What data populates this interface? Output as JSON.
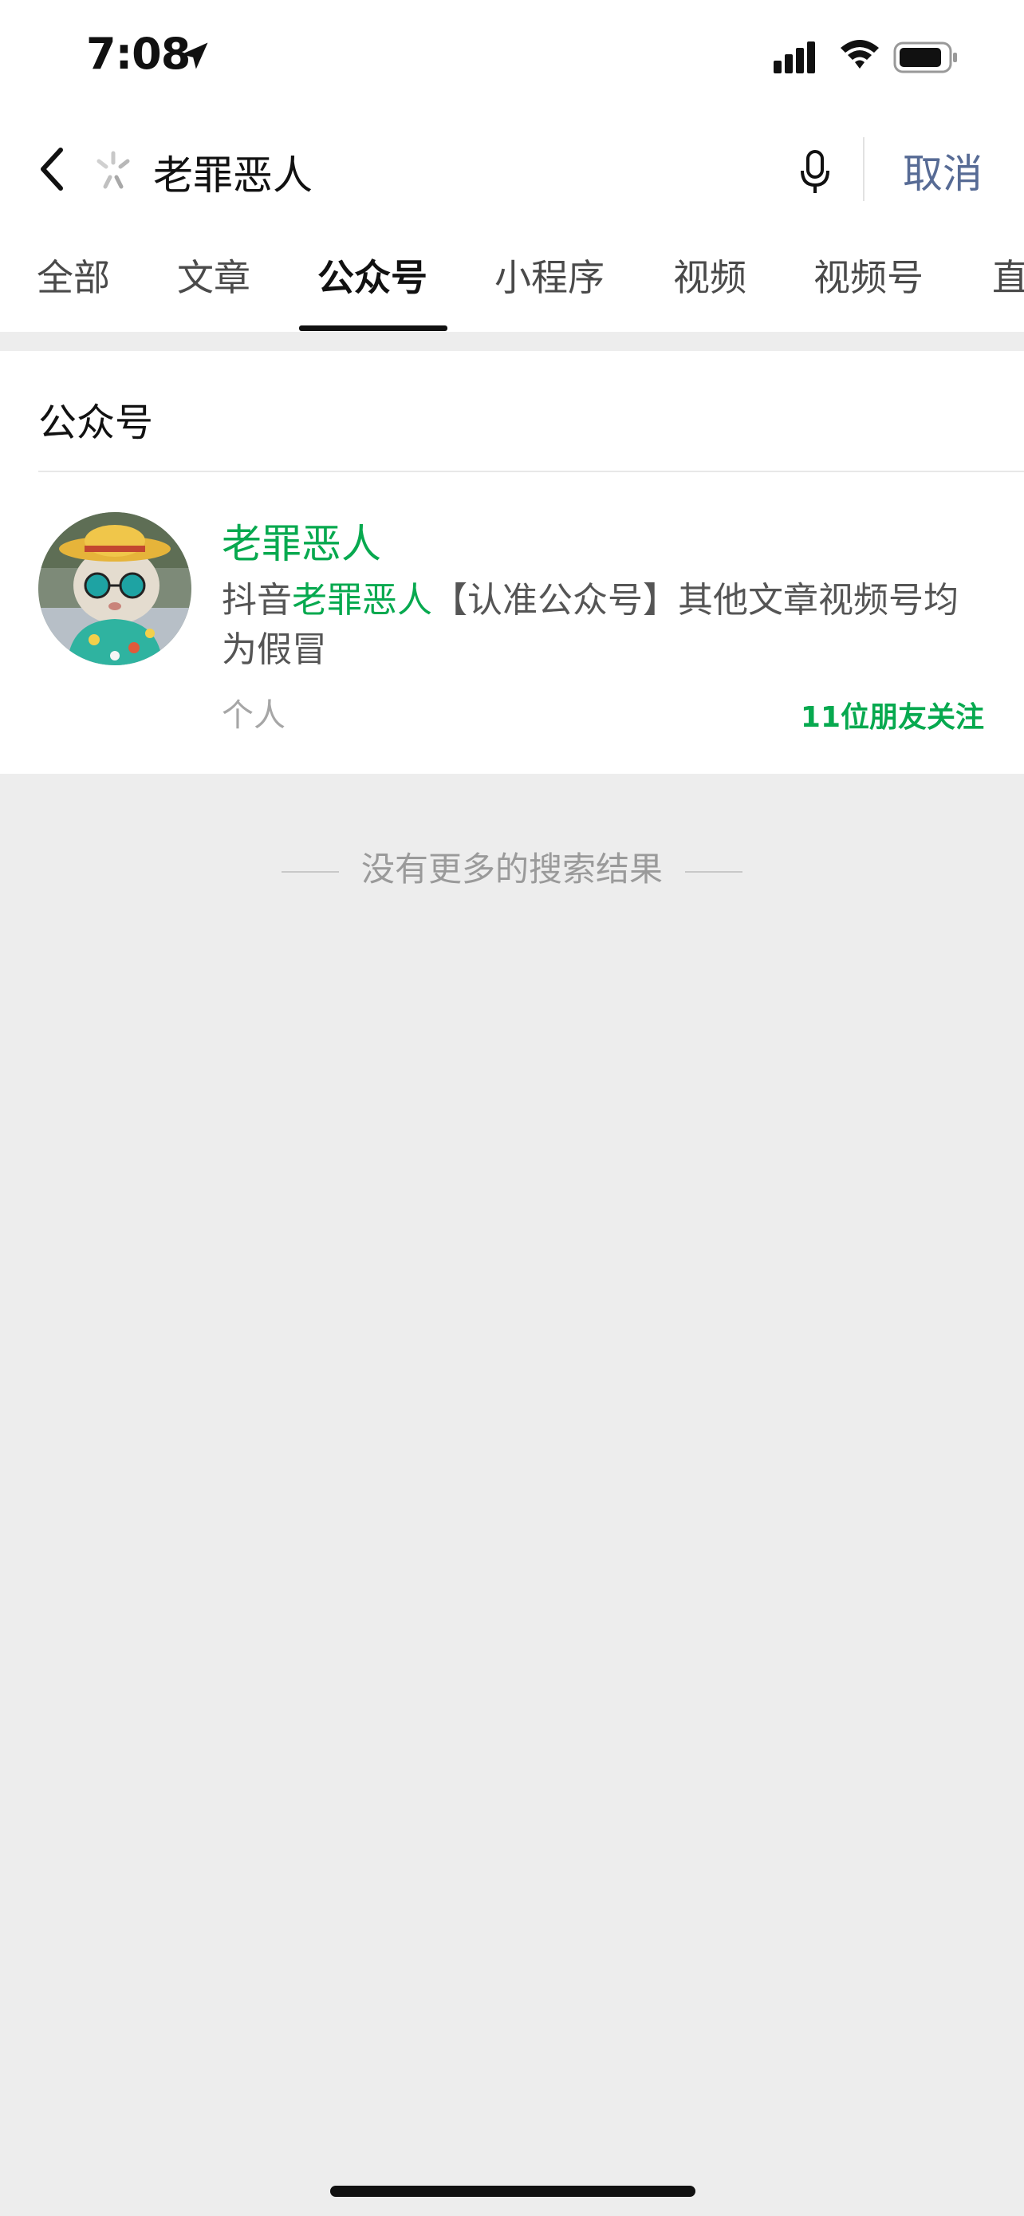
{
  "status_bar": {
    "time": "7:08"
  },
  "search": {
    "query": "老罪恶人",
    "cancel_label": "取消"
  },
  "tabs": [
    {
      "label": "全部"
    },
    {
      "label": "文章"
    },
    {
      "label": "公众号",
      "active": true
    },
    {
      "label": "小程序"
    },
    {
      "label": "视频"
    },
    {
      "label": "视频号"
    },
    {
      "label": "直"
    }
  ],
  "section": {
    "title": "公众号"
  },
  "result": {
    "name": "老罪恶人",
    "desc_prefix": "抖音",
    "desc_highlight": "老罪恶人",
    "desc_suffix": "【认准公众号】其他文章视频号均为假冒",
    "type": "个人",
    "friends_following": "11位朋友关注"
  },
  "footer": {
    "no_more": "没有更多的搜索结果"
  },
  "colors": {
    "accent_green": "#07a94f",
    "link_blue": "#576b95",
    "page_bg": "#ededed"
  }
}
